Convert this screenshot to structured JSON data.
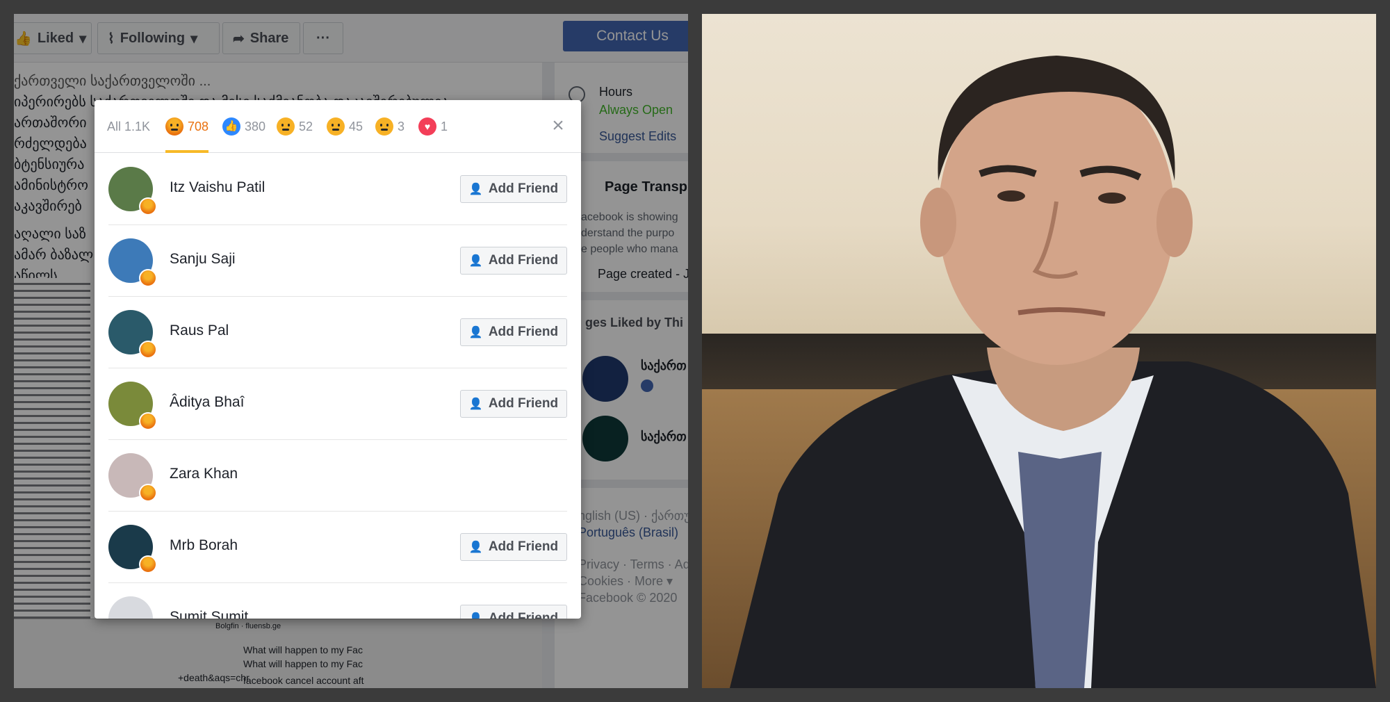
{
  "toolbar": {
    "liked": "Liked",
    "following": "Following",
    "share": "Share",
    "more": "···",
    "contact": "Contact Us"
  },
  "post": {
    "lines": [
      "იპერირებს საქართველოში და მისი საქმიანობა დაკავშირებულია",
      "ართაშორი",
      "რძელდება",
      "ბტენსიურა",
      "ამინისტრო",
      "აკავშირებ",
      "აღალი საზ",
      "ამარ ბაზალ",
      "აწილს."
    ]
  },
  "bottom_table": {
    "cells": [
      "What will happen to my Fac",
      "What will happen to my Fac",
      "+death&aqs=chr",
      "facebook cancel account aft",
      "Bolgfin · fluensb.ge"
    ]
  },
  "sidebar": {
    "hours_label": "Hours",
    "hours_value": "Always Open",
    "suggest_edits": "Suggest Edits",
    "page_transparency": "Page Transp",
    "transparency_lines": [
      "acebook is showing",
      "derstand the purpo",
      "e people who mana"
    ],
    "page_created": "Page created - J",
    "pages_liked": "ges Liked by Thi",
    "liked_pages": [
      "საქართ",
      "საქართ"
    ],
    "languages": [
      "nglish (US) · ქართუ",
      "Português (Brasil)"
    ],
    "footer_links": [
      "Privacy · Terms · Adv",
      "Cookies · More ▾",
      "Facebook © 2020"
    ]
  },
  "reactions_modal": {
    "tabs": [
      {
        "label": "All 1.1K",
        "icon": "all"
      },
      {
        "count": "708",
        "icon": "angry"
      },
      {
        "count": "380",
        "icon": "like"
      },
      {
        "count": "52",
        "icon": "wow"
      },
      {
        "count": "45",
        "icon": "sad"
      },
      {
        "count": "3",
        "icon": "haha"
      },
      {
        "count": "1",
        "icon": "love"
      }
    ],
    "close": "×",
    "people": [
      {
        "name": "Itz Vaishu Patil",
        "button": "Add Friend",
        "avatar_color": "#5a7a48"
      },
      {
        "name": "Sanju Saji",
        "button": "Add Friend",
        "avatar_color": "#3d7ab8"
      },
      {
        "name": "Raus Pal",
        "button": "Add Friend",
        "avatar_color": "#2a5a6a"
      },
      {
        "name": "Âditya Bhaî",
        "button": "Add Friend",
        "avatar_color": "#7a8a3a"
      },
      {
        "name": "Zara Khan",
        "button": "",
        "avatar_color": "#c8b8b8"
      },
      {
        "name": "Mrb Borah",
        "button": "Add Friend",
        "avatar_color": "#1a3a4a"
      },
      {
        "name": "Sumit Sumit",
        "button": "Add Friend",
        "avatar_color": "#d8dadf"
      }
    ]
  },
  "colors": {
    "facebook_blue": "#4267b2",
    "angry_orange": "#e9710f",
    "open_green": "#42b72a"
  }
}
